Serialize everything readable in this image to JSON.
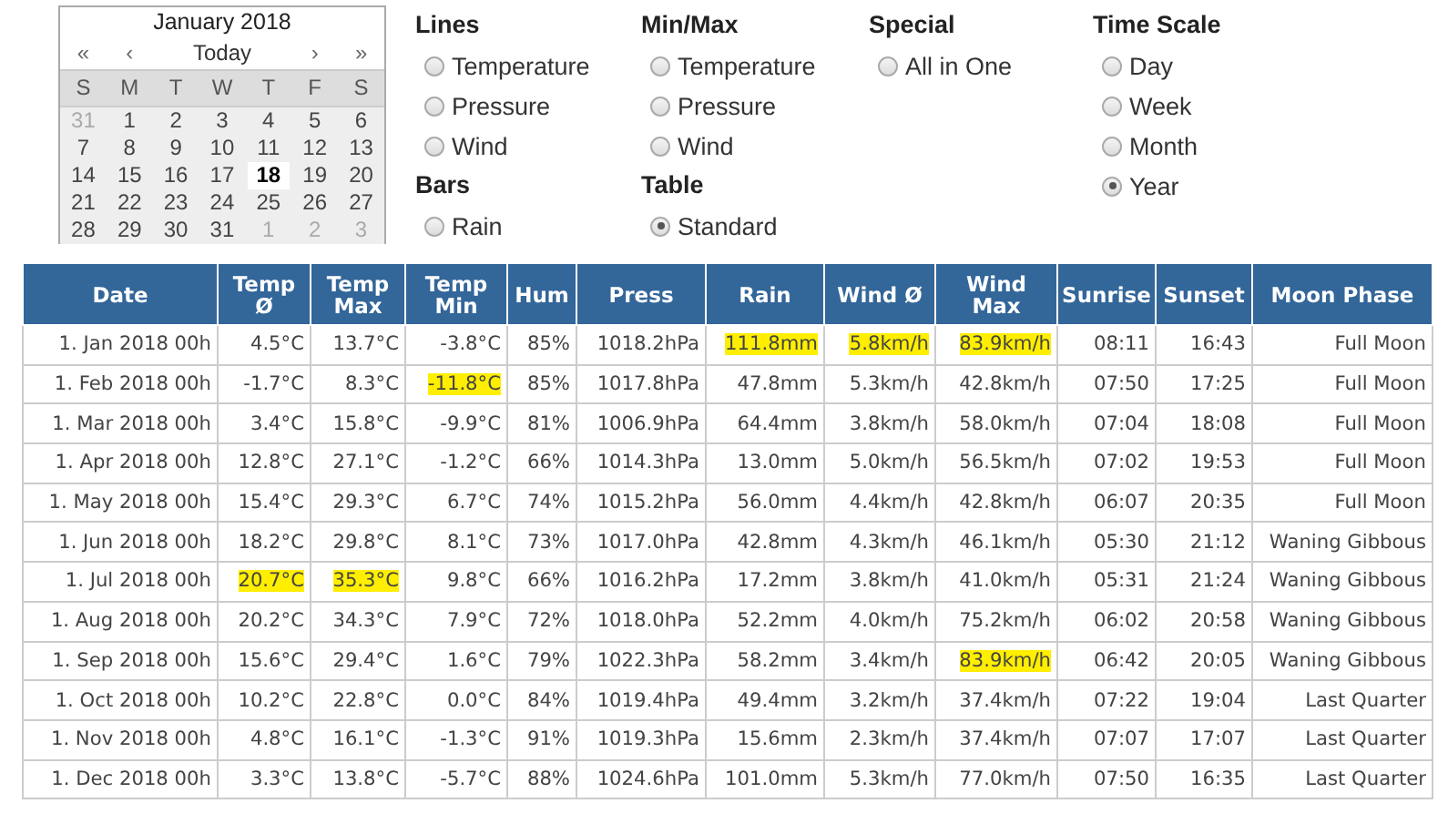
{
  "calendar": {
    "title": "January 2018",
    "nav": {
      "prev_year": "«",
      "prev_month": "‹",
      "today": "Today",
      "next_month": "›",
      "next_year": "»"
    },
    "weekdays": [
      "S",
      "M",
      "T",
      "W",
      "T",
      "F",
      "S"
    ],
    "weeks": [
      [
        {
          "day": "31",
          "muted": true,
          "selected": false
        },
        {
          "day": "1",
          "muted": false,
          "selected": false
        },
        {
          "day": "2",
          "muted": false,
          "selected": false
        },
        {
          "day": "3",
          "muted": false,
          "selected": false
        },
        {
          "day": "4",
          "muted": false,
          "selected": false
        },
        {
          "day": "5",
          "muted": false,
          "selected": false
        },
        {
          "day": "6",
          "muted": false,
          "selected": false
        }
      ],
      [
        {
          "day": "7",
          "muted": false,
          "selected": false
        },
        {
          "day": "8",
          "muted": false,
          "selected": false
        },
        {
          "day": "9",
          "muted": false,
          "selected": false
        },
        {
          "day": "10",
          "muted": false,
          "selected": false
        },
        {
          "day": "11",
          "muted": false,
          "selected": false
        },
        {
          "day": "12",
          "muted": false,
          "selected": false
        },
        {
          "day": "13",
          "muted": false,
          "selected": false
        }
      ],
      [
        {
          "day": "14",
          "muted": false,
          "selected": false
        },
        {
          "day": "15",
          "muted": false,
          "selected": false
        },
        {
          "day": "16",
          "muted": false,
          "selected": false
        },
        {
          "day": "17",
          "muted": false,
          "selected": false
        },
        {
          "day": "18",
          "muted": false,
          "selected": true
        },
        {
          "day": "19",
          "muted": false,
          "selected": false
        },
        {
          "day": "20",
          "muted": false,
          "selected": false
        }
      ],
      [
        {
          "day": "21",
          "muted": false,
          "selected": false
        },
        {
          "day": "22",
          "muted": false,
          "selected": false
        },
        {
          "day": "23",
          "muted": false,
          "selected": false
        },
        {
          "day": "24",
          "muted": false,
          "selected": false
        },
        {
          "day": "25",
          "muted": false,
          "selected": false
        },
        {
          "day": "26",
          "muted": false,
          "selected": false
        },
        {
          "day": "27",
          "muted": false,
          "selected": false
        }
      ],
      [
        {
          "day": "28",
          "muted": false,
          "selected": false
        },
        {
          "day": "29",
          "muted": false,
          "selected": false
        },
        {
          "day": "30",
          "muted": false,
          "selected": false
        },
        {
          "day": "31",
          "muted": false,
          "selected": false
        },
        {
          "day": "1",
          "muted": true,
          "selected": false
        },
        {
          "day": "2",
          "muted": true,
          "selected": false
        },
        {
          "day": "3",
          "muted": true,
          "selected": false
        }
      ]
    ]
  },
  "option_columns": [
    {
      "groups": [
        {
          "title": "Lines",
          "options": [
            {
              "label": "Temperature",
              "selected": false
            },
            {
              "label": "Pressure",
              "selected": false
            },
            {
              "label": "Wind",
              "selected": false
            }
          ]
        },
        {
          "title": "Bars",
          "options": [
            {
              "label": "Rain",
              "selected": false
            }
          ]
        }
      ]
    },
    {
      "groups": [
        {
          "title": "Min/Max",
          "options": [
            {
              "label": "Temperature",
              "selected": false
            },
            {
              "label": "Pressure",
              "selected": false
            },
            {
              "label": "Wind",
              "selected": false
            }
          ]
        },
        {
          "title": "Table",
          "options": [
            {
              "label": "Standard",
              "selected": true
            }
          ]
        }
      ]
    },
    {
      "groups": [
        {
          "title": "Special",
          "options": [
            {
              "label": "All in One",
              "selected": false
            }
          ]
        }
      ]
    },
    {
      "groups": [
        {
          "title": "Time Scale",
          "options": [
            {
              "label": "Day",
              "selected": false
            },
            {
              "label": "Week",
              "selected": false
            },
            {
              "label": "Month",
              "selected": false
            },
            {
              "label": "Year",
              "selected": true
            }
          ]
        }
      ]
    }
  ],
  "table": {
    "columns": [
      "Date",
      "Temp Ø",
      "Temp Max",
      "Temp Min",
      "Hum",
      "Press",
      "Rain",
      "Wind Ø",
      "Wind Max",
      "Sunrise",
      "Sunset",
      "Moon Phase"
    ],
    "rows": [
      [
        {
          "text": "1. Jan 2018 00h",
          "highlighted": false
        },
        {
          "text": "4.5°C",
          "highlighted": false
        },
        {
          "text": "13.7°C",
          "highlighted": false
        },
        {
          "text": "-3.8°C",
          "highlighted": false
        },
        {
          "text": "85%",
          "highlighted": false
        },
        {
          "text": "1018.2hPa",
          "highlighted": false
        },
        {
          "text": "111.8mm",
          "highlighted": true
        },
        {
          "text": "5.8km/h",
          "highlighted": true
        },
        {
          "text": "83.9km/h",
          "highlighted": true
        },
        {
          "text": "08:11",
          "highlighted": false
        },
        {
          "text": "16:43",
          "highlighted": false
        },
        {
          "text": "Full Moon",
          "highlighted": false
        }
      ],
      [
        {
          "text": "1. Feb 2018 00h",
          "highlighted": false
        },
        {
          "text": "-1.7°C",
          "highlighted": false
        },
        {
          "text": "8.3°C",
          "highlighted": false
        },
        {
          "text": "-11.8°C",
          "highlighted": true
        },
        {
          "text": "85%",
          "highlighted": false
        },
        {
          "text": "1017.8hPa",
          "highlighted": false
        },
        {
          "text": "47.8mm",
          "highlighted": false
        },
        {
          "text": "5.3km/h",
          "highlighted": false
        },
        {
          "text": "42.8km/h",
          "highlighted": false
        },
        {
          "text": "07:50",
          "highlighted": false
        },
        {
          "text": "17:25",
          "highlighted": false
        },
        {
          "text": "Full Moon",
          "highlighted": false
        }
      ],
      [
        {
          "text": "1. Mar 2018 00h",
          "highlighted": false
        },
        {
          "text": "3.4°C",
          "highlighted": false
        },
        {
          "text": "15.8°C",
          "highlighted": false
        },
        {
          "text": "-9.9°C",
          "highlighted": false
        },
        {
          "text": "81%",
          "highlighted": false
        },
        {
          "text": "1006.9hPa",
          "highlighted": false
        },
        {
          "text": "64.4mm",
          "highlighted": false
        },
        {
          "text": "3.8km/h",
          "highlighted": false
        },
        {
          "text": "58.0km/h",
          "highlighted": false
        },
        {
          "text": "07:04",
          "highlighted": false
        },
        {
          "text": "18:08",
          "highlighted": false
        },
        {
          "text": "Full Moon",
          "highlighted": false
        }
      ],
      [
        {
          "text": "1. Apr 2018 00h",
          "highlighted": false
        },
        {
          "text": "12.8°C",
          "highlighted": false
        },
        {
          "text": "27.1°C",
          "highlighted": false
        },
        {
          "text": "-1.2°C",
          "highlighted": false
        },
        {
          "text": "66%",
          "highlighted": false
        },
        {
          "text": "1014.3hPa",
          "highlighted": false
        },
        {
          "text": "13.0mm",
          "highlighted": false
        },
        {
          "text": "5.0km/h",
          "highlighted": false
        },
        {
          "text": "56.5km/h",
          "highlighted": false
        },
        {
          "text": "07:02",
          "highlighted": false
        },
        {
          "text": "19:53",
          "highlighted": false
        },
        {
          "text": "Full Moon",
          "highlighted": false
        }
      ],
      [
        {
          "text": "1. May 2018 00h",
          "highlighted": false
        },
        {
          "text": "15.4°C",
          "highlighted": false
        },
        {
          "text": "29.3°C",
          "highlighted": false
        },
        {
          "text": "6.7°C",
          "highlighted": false
        },
        {
          "text": "74%",
          "highlighted": false
        },
        {
          "text": "1015.2hPa",
          "highlighted": false
        },
        {
          "text": "56.0mm",
          "highlighted": false
        },
        {
          "text": "4.4km/h",
          "highlighted": false
        },
        {
          "text": "42.8km/h",
          "highlighted": false
        },
        {
          "text": "06:07",
          "highlighted": false
        },
        {
          "text": "20:35",
          "highlighted": false
        },
        {
          "text": "Full Moon",
          "highlighted": false
        }
      ],
      [
        {
          "text": "1. Jun 2018 00h",
          "highlighted": false
        },
        {
          "text": "18.2°C",
          "highlighted": false
        },
        {
          "text": "29.8°C",
          "highlighted": false
        },
        {
          "text": "8.1°C",
          "highlighted": false
        },
        {
          "text": "73%",
          "highlighted": false
        },
        {
          "text": "1017.0hPa",
          "highlighted": false
        },
        {
          "text": "42.8mm",
          "highlighted": false
        },
        {
          "text": "4.3km/h",
          "highlighted": false
        },
        {
          "text": "46.1km/h",
          "highlighted": false
        },
        {
          "text": "05:30",
          "highlighted": false
        },
        {
          "text": "21:12",
          "highlighted": false
        },
        {
          "text": "Waning Gibbous",
          "highlighted": false
        }
      ],
      [
        {
          "text": "1. Jul 2018 00h",
          "highlighted": false
        },
        {
          "text": "20.7°C",
          "highlighted": true
        },
        {
          "text": "35.3°C",
          "highlighted": true
        },
        {
          "text": "9.8°C",
          "highlighted": false
        },
        {
          "text": "66%",
          "highlighted": false
        },
        {
          "text": "1016.2hPa",
          "highlighted": false
        },
        {
          "text": "17.2mm",
          "highlighted": false
        },
        {
          "text": "3.8km/h",
          "highlighted": false
        },
        {
          "text": "41.0km/h",
          "highlighted": false
        },
        {
          "text": "05:31",
          "highlighted": false
        },
        {
          "text": "21:24",
          "highlighted": false
        },
        {
          "text": "Waning Gibbous",
          "highlighted": false
        }
      ],
      [
        {
          "text": "1. Aug 2018 00h",
          "highlighted": false
        },
        {
          "text": "20.2°C",
          "highlighted": false
        },
        {
          "text": "34.3°C",
          "highlighted": false
        },
        {
          "text": "7.9°C",
          "highlighted": false
        },
        {
          "text": "72%",
          "highlighted": false
        },
        {
          "text": "1018.0hPa",
          "highlighted": false
        },
        {
          "text": "52.2mm",
          "highlighted": false
        },
        {
          "text": "4.0km/h",
          "highlighted": false
        },
        {
          "text": "75.2km/h",
          "highlighted": false
        },
        {
          "text": "06:02",
          "highlighted": false
        },
        {
          "text": "20:58",
          "highlighted": false
        },
        {
          "text": "Waning Gibbous",
          "highlighted": false
        }
      ],
      [
        {
          "text": "1. Sep 2018 00h",
          "highlighted": false
        },
        {
          "text": "15.6°C",
          "highlighted": false
        },
        {
          "text": "29.4°C",
          "highlighted": false
        },
        {
          "text": "1.6°C",
          "highlighted": false
        },
        {
          "text": "79%",
          "highlighted": false
        },
        {
          "text": "1022.3hPa",
          "highlighted": false
        },
        {
          "text": "58.2mm",
          "highlighted": false
        },
        {
          "text": "3.4km/h",
          "highlighted": false
        },
        {
          "text": "83.9km/h",
          "highlighted": true
        },
        {
          "text": "06:42",
          "highlighted": false
        },
        {
          "text": "20:05",
          "highlighted": false
        },
        {
          "text": "Waning Gibbous",
          "highlighted": false
        }
      ],
      [
        {
          "text": "1. Oct 2018 00h",
          "highlighted": false
        },
        {
          "text": "10.2°C",
          "highlighted": false
        },
        {
          "text": "22.8°C",
          "highlighted": false
        },
        {
          "text": "0.0°C",
          "highlighted": false
        },
        {
          "text": "84%",
          "highlighted": false
        },
        {
          "text": "1019.4hPa",
          "highlighted": false
        },
        {
          "text": "49.4mm",
          "highlighted": false
        },
        {
          "text": "3.2km/h",
          "highlighted": false
        },
        {
          "text": "37.4km/h",
          "highlighted": false
        },
        {
          "text": "07:22",
          "highlighted": false
        },
        {
          "text": "19:04",
          "highlighted": false
        },
        {
          "text": "Last Quarter",
          "highlighted": false
        }
      ],
      [
        {
          "text": "1. Nov 2018 00h",
          "highlighted": false
        },
        {
          "text": "4.8°C",
          "highlighted": false
        },
        {
          "text": "16.1°C",
          "highlighted": false
        },
        {
          "text": "-1.3°C",
          "highlighted": false
        },
        {
          "text": "91%",
          "highlighted": false
        },
        {
          "text": "1019.3hPa",
          "highlighted": false
        },
        {
          "text": "15.6mm",
          "highlighted": false
        },
        {
          "text": "2.3km/h",
          "highlighted": false
        },
        {
          "text": "37.4km/h",
          "highlighted": false
        },
        {
          "text": "07:07",
          "highlighted": false
        },
        {
          "text": "17:07",
          "highlighted": false
        },
        {
          "text": "Last Quarter",
          "highlighted": false
        }
      ],
      [
        {
          "text": "1. Dec 2018 00h",
          "highlighted": false
        },
        {
          "text": "3.3°C",
          "highlighted": false
        },
        {
          "text": "13.8°C",
          "highlighted": false
        },
        {
          "text": "-5.7°C",
          "highlighted": false
        },
        {
          "text": "88%",
          "highlighted": false
        },
        {
          "text": "1024.6hPa",
          "highlighted": false
        },
        {
          "text": "101.0mm",
          "highlighted": false
        },
        {
          "text": "5.3km/h",
          "highlighted": false
        },
        {
          "text": "77.0km/h",
          "highlighted": false
        },
        {
          "text": "07:50",
          "highlighted": false
        },
        {
          "text": "16:35",
          "highlighted": false
        },
        {
          "text": "Last Quarter",
          "highlighted": false
        }
      ]
    ]
  }
}
